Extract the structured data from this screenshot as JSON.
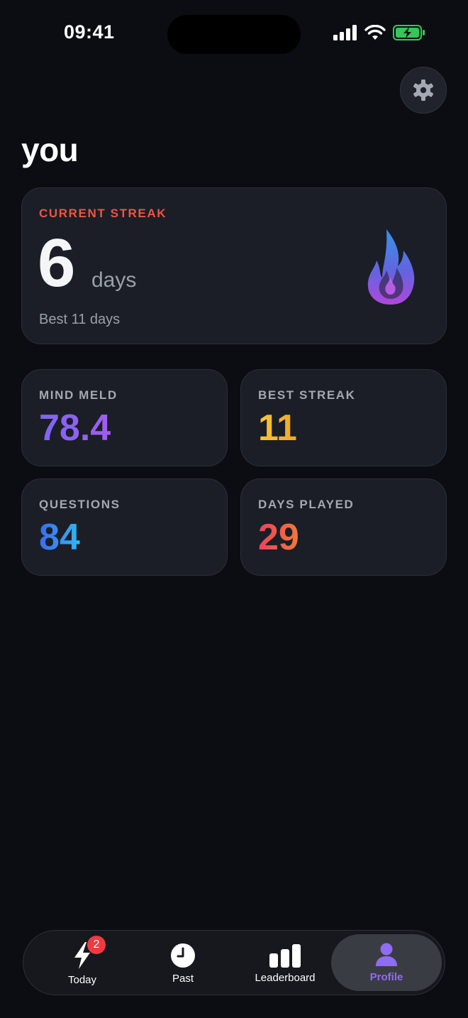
{
  "status_bar": {
    "time": "09:41"
  },
  "header": {
    "title": "you"
  },
  "streak": {
    "label": "CURRENT STREAK",
    "value": "6",
    "unit": "days",
    "best": "Best 11 days"
  },
  "stats": [
    {
      "label": "MIND MELD",
      "value": "78.4"
    },
    {
      "label": "BEST STREAK",
      "value": "11"
    },
    {
      "label": "QUESTIONS",
      "value": "84"
    },
    {
      "label": "DAYS PLAYED",
      "value": "29"
    }
  ],
  "tabs": [
    {
      "label": "Today",
      "icon": "bolt-icon",
      "badge": "2"
    },
    {
      "label": "Past",
      "icon": "clock-icon"
    },
    {
      "label": "Leaderboard",
      "icon": "bar-chart-icon"
    },
    {
      "label": "Profile",
      "icon": "person-icon",
      "active": true
    }
  ],
  "colors": {
    "background": "#0b0d12",
    "card": "#1b1e26",
    "streak_label": "#f0553f",
    "accent_purple": "#8f6cf2",
    "badge": "#ee3b40"
  }
}
